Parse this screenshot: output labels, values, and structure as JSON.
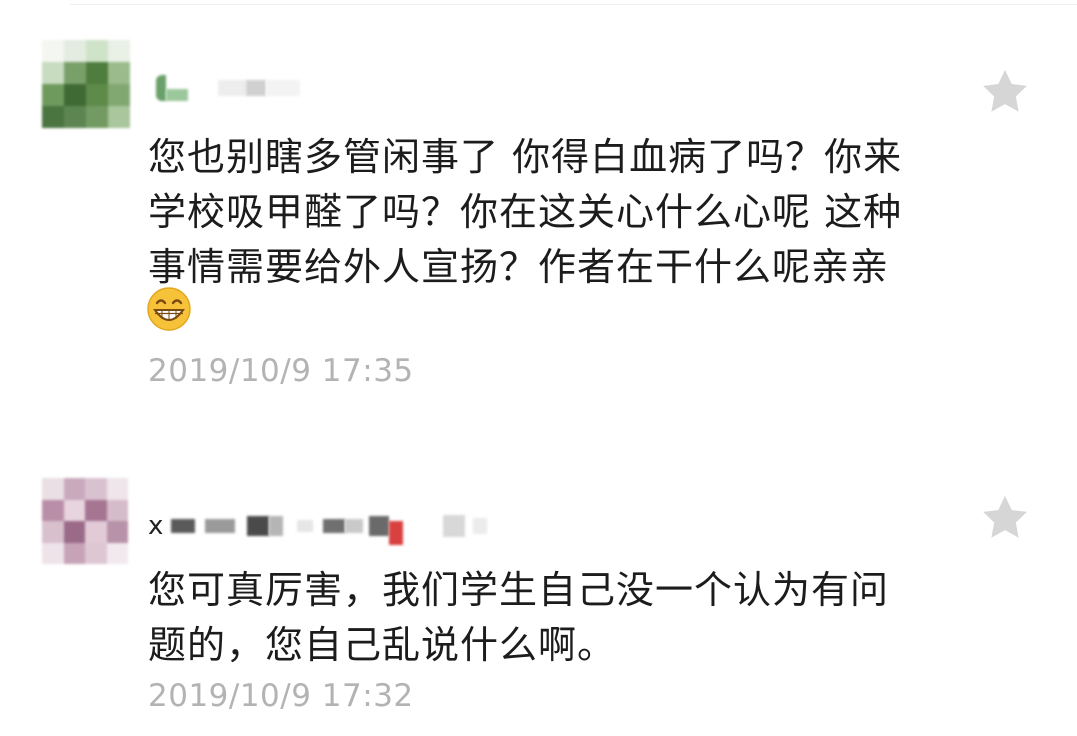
{
  "comments": [
    {
      "nickname_prefix": "",
      "body_lines": [
        "您也别瞎多管闲事了 你得白血病了吗？你来",
        "学校吸甲醛了吗？你在这关心什么心呢 这种",
        "事情需要给外人宣扬？作者在干什么呢亲亲"
      ],
      "emoji": "grin-emoji",
      "timestamp": "2019/10/9 17:35",
      "star_icon": "star-icon"
    },
    {
      "nickname_prefix": "x",
      "body_lines": [
        "您可真厉害，我们学生自己没一个认为有问",
        "题的，您自己乱说什么啊。"
      ],
      "timestamp": "2019/10/9 17:32",
      "star_icon": "star-icon"
    }
  ],
  "colors": {
    "text": "#1c1c1c",
    "timestamp": "#b3b3b3",
    "star": "#d6d6d6",
    "emoji_face": "#f6c23a"
  }
}
